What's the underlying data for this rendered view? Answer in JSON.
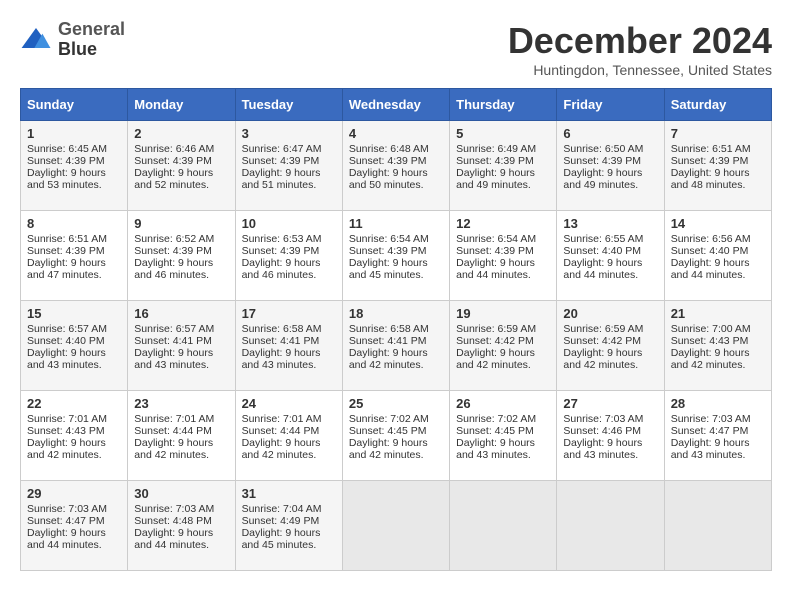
{
  "header": {
    "logo_line1": "General",
    "logo_line2": "Blue",
    "title": "December 2024",
    "subtitle": "Huntingdon, Tennessee, United States"
  },
  "days_of_week": [
    "Sunday",
    "Monday",
    "Tuesday",
    "Wednesday",
    "Thursday",
    "Friday",
    "Saturday"
  ],
  "weeks": [
    [
      {
        "day": "1",
        "sunrise": "6:45 AM",
        "sunset": "4:39 PM",
        "daylight": "9 hours and 53 minutes."
      },
      {
        "day": "2",
        "sunrise": "6:46 AM",
        "sunset": "4:39 PM",
        "daylight": "9 hours and 52 minutes."
      },
      {
        "day": "3",
        "sunrise": "6:47 AM",
        "sunset": "4:39 PM",
        "daylight": "9 hours and 51 minutes."
      },
      {
        "day": "4",
        "sunrise": "6:48 AM",
        "sunset": "4:39 PM",
        "daylight": "9 hours and 50 minutes."
      },
      {
        "day": "5",
        "sunrise": "6:49 AM",
        "sunset": "4:39 PM",
        "daylight": "9 hours and 49 minutes."
      },
      {
        "day": "6",
        "sunrise": "6:50 AM",
        "sunset": "4:39 PM",
        "daylight": "9 hours and 49 minutes."
      },
      {
        "day": "7",
        "sunrise": "6:51 AM",
        "sunset": "4:39 PM",
        "daylight": "9 hours and 48 minutes."
      }
    ],
    [
      {
        "day": "8",
        "sunrise": "6:51 AM",
        "sunset": "4:39 PM",
        "daylight": "9 hours and 47 minutes."
      },
      {
        "day": "9",
        "sunrise": "6:52 AM",
        "sunset": "4:39 PM",
        "daylight": "9 hours and 46 minutes."
      },
      {
        "day": "10",
        "sunrise": "6:53 AM",
        "sunset": "4:39 PM",
        "daylight": "9 hours and 46 minutes."
      },
      {
        "day": "11",
        "sunrise": "6:54 AM",
        "sunset": "4:39 PM",
        "daylight": "9 hours and 45 minutes."
      },
      {
        "day": "12",
        "sunrise": "6:54 AM",
        "sunset": "4:39 PM",
        "daylight": "9 hours and 44 minutes."
      },
      {
        "day": "13",
        "sunrise": "6:55 AM",
        "sunset": "4:40 PM",
        "daylight": "9 hours and 44 minutes."
      },
      {
        "day": "14",
        "sunrise": "6:56 AM",
        "sunset": "4:40 PM",
        "daylight": "9 hours and 44 minutes."
      }
    ],
    [
      {
        "day": "15",
        "sunrise": "6:57 AM",
        "sunset": "4:40 PM",
        "daylight": "9 hours and 43 minutes."
      },
      {
        "day": "16",
        "sunrise": "6:57 AM",
        "sunset": "4:41 PM",
        "daylight": "9 hours and 43 minutes."
      },
      {
        "day": "17",
        "sunrise": "6:58 AM",
        "sunset": "4:41 PM",
        "daylight": "9 hours and 43 minutes."
      },
      {
        "day": "18",
        "sunrise": "6:58 AM",
        "sunset": "4:41 PM",
        "daylight": "9 hours and 42 minutes."
      },
      {
        "day": "19",
        "sunrise": "6:59 AM",
        "sunset": "4:42 PM",
        "daylight": "9 hours and 42 minutes."
      },
      {
        "day": "20",
        "sunrise": "6:59 AM",
        "sunset": "4:42 PM",
        "daylight": "9 hours and 42 minutes."
      },
      {
        "day": "21",
        "sunrise": "7:00 AM",
        "sunset": "4:43 PM",
        "daylight": "9 hours and 42 minutes."
      }
    ],
    [
      {
        "day": "22",
        "sunrise": "7:01 AM",
        "sunset": "4:43 PM",
        "daylight": "9 hours and 42 minutes."
      },
      {
        "day": "23",
        "sunrise": "7:01 AM",
        "sunset": "4:44 PM",
        "daylight": "9 hours and 42 minutes."
      },
      {
        "day": "24",
        "sunrise": "7:01 AM",
        "sunset": "4:44 PM",
        "daylight": "9 hours and 42 minutes."
      },
      {
        "day": "25",
        "sunrise": "7:02 AM",
        "sunset": "4:45 PM",
        "daylight": "9 hours and 42 minutes."
      },
      {
        "day": "26",
        "sunrise": "7:02 AM",
        "sunset": "4:45 PM",
        "daylight": "9 hours and 43 minutes."
      },
      {
        "day": "27",
        "sunrise": "7:03 AM",
        "sunset": "4:46 PM",
        "daylight": "9 hours and 43 minutes."
      },
      {
        "day": "28",
        "sunrise": "7:03 AM",
        "sunset": "4:47 PM",
        "daylight": "9 hours and 43 minutes."
      }
    ],
    [
      {
        "day": "29",
        "sunrise": "7:03 AM",
        "sunset": "4:47 PM",
        "daylight": "9 hours and 44 minutes."
      },
      {
        "day": "30",
        "sunrise": "7:03 AM",
        "sunset": "4:48 PM",
        "daylight": "9 hours and 44 minutes."
      },
      {
        "day": "31",
        "sunrise": "7:04 AM",
        "sunset": "4:49 PM",
        "daylight": "9 hours and 45 minutes."
      },
      null,
      null,
      null,
      null
    ]
  ]
}
